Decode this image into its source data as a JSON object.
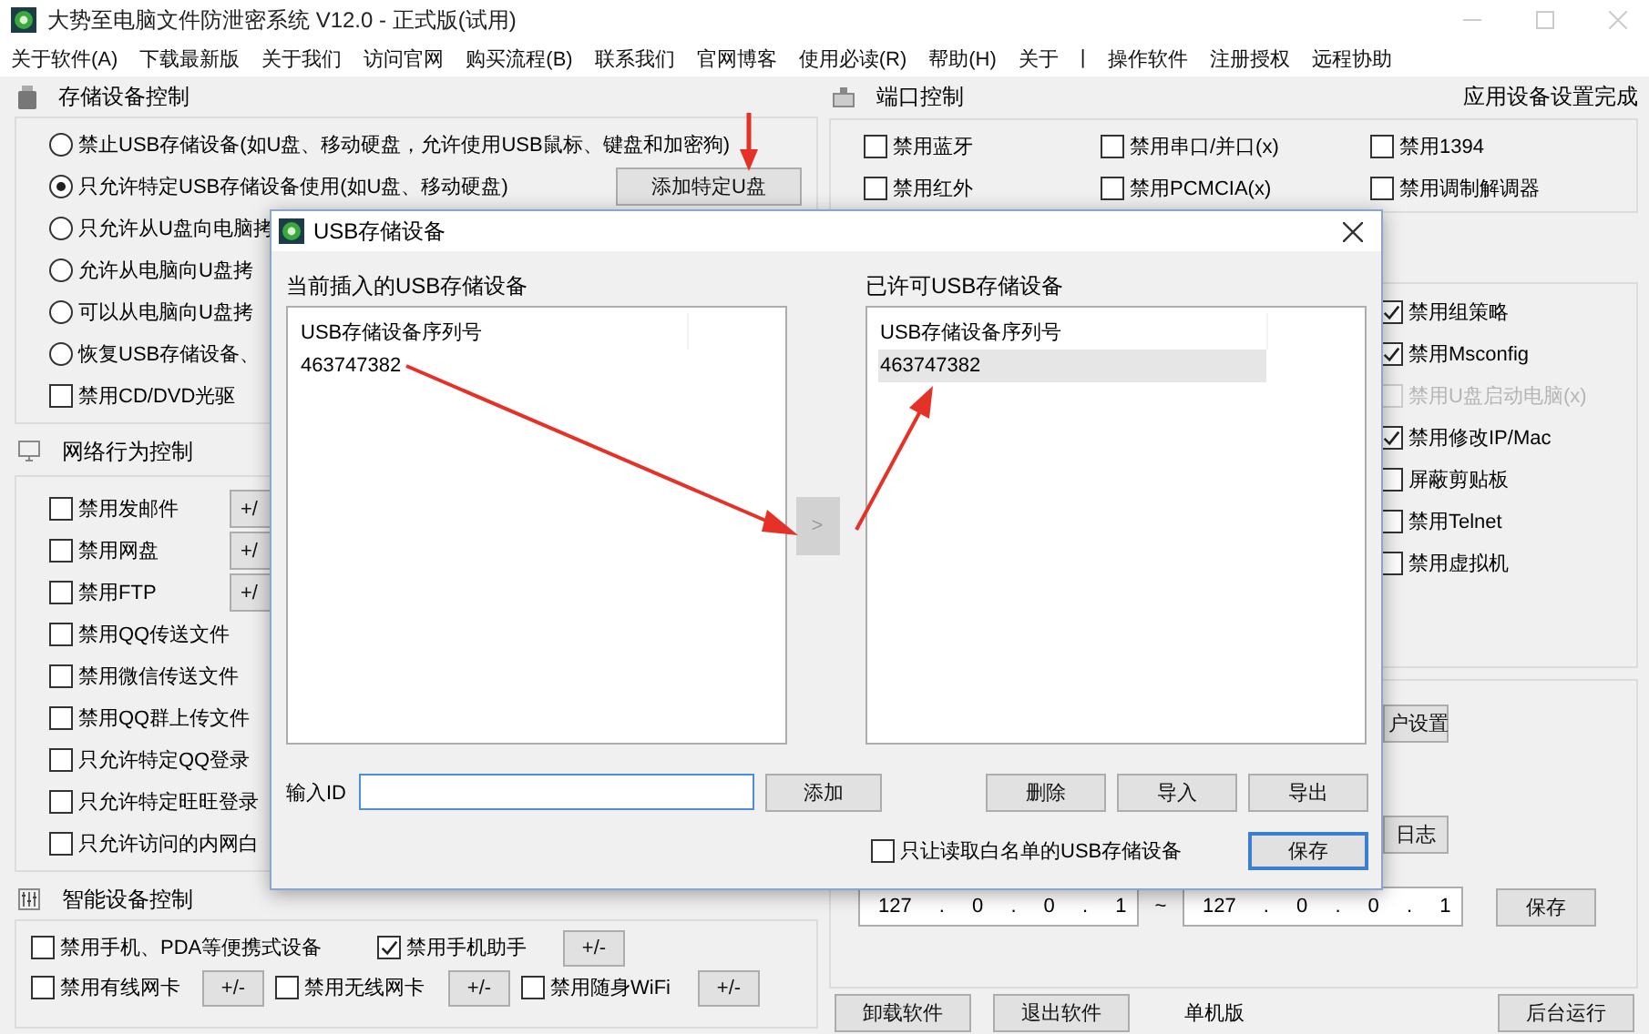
{
  "window": {
    "title": "大势至电脑文件防泄密系统 V12.0 - 正式版(试用)"
  },
  "menu": [
    "关于软件(A)",
    "下载最新版",
    "关于我们",
    "访问官网",
    "购买流程(B)",
    "联系我们",
    "官网博客",
    "使用必读(R)",
    "帮助(H)",
    "关于",
    "|",
    "操作软件",
    "注册授权",
    "远程协助"
  ],
  "storage": {
    "title": "存储设备控制",
    "add_button": "添加特定U盘",
    "options": [
      {
        "label": "禁止USB存储设备(如U盘、移动硬盘，允许使用USB鼠标、键盘和加密狗)",
        "selected": false
      },
      {
        "label": "只允许特定USB存储设备使用(如U盘、移动硬盘)",
        "selected": true
      },
      {
        "label": "只允许从U盘向电脑拷",
        "selected": false
      },
      {
        "label": "允许从电脑向U盘拷",
        "selected": false
      },
      {
        "label": "可以从电脑向U盘拷",
        "selected": false
      },
      {
        "label": "恢复USB存储设备、",
        "selected": false
      }
    ],
    "cd_dvd": {
      "label": "禁用CD/DVD光驱",
      "checked": false
    }
  },
  "network": {
    "title": "网络行为控制",
    "items": [
      {
        "label": "禁用发邮件",
        "checked": false,
        "button": "+/"
      },
      {
        "label": "禁用网盘",
        "checked": false,
        "button": "+/"
      },
      {
        "label": "禁用FTP",
        "checked": false,
        "button": "+/"
      },
      {
        "label": "禁用QQ传送文件",
        "checked": false
      },
      {
        "label": "禁用微信传送文件",
        "checked": false
      },
      {
        "label": "禁用QQ群上传文件",
        "checked": false
      },
      {
        "label": "只允许特定QQ登录",
        "checked": false
      },
      {
        "label": "只允许特定旺旺登录",
        "checked": false
      },
      {
        "label": "只允许访问的内网白",
        "checked": false
      }
    ]
  },
  "smart": {
    "title": "智能设备控制",
    "rows": [
      [
        {
          "label": "禁用手机、PDA等便携式设备",
          "checked": false
        },
        {
          "label": "禁用手机助手",
          "checked": true,
          "button": "+/-"
        }
      ],
      [
        {
          "label": "禁用有线网卡",
          "checked": false,
          "button": "+/-"
        },
        {
          "label": "禁用无线网卡",
          "checked": false,
          "button": "+/-"
        },
        {
          "label": "禁用随身WiFi",
          "checked": false,
          "button": "+/-"
        }
      ]
    ]
  },
  "ports": {
    "title": "端口控制",
    "status": "应用设备设置完成",
    "items": [
      {
        "label": "禁用蓝牙",
        "checked": false
      },
      {
        "label": "禁用串口/并口(x)",
        "checked": false
      },
      {
        "label": "禁用1394",
        "checked": false
      },
      {
        "label": "禁用红外",
        "checked": false
      },
      {
        "label": "禁用PCMCIA(x)",
        "checked": false
      },
      {
        "label": "禁用调制解调器",
        "checked": false
      }
    ]
  },
  "system": {
    "items": [
      {
        "label": "禁用组策略",
        "checked": true,
        "disabled": false
      },
      {
        "label": "禁用Msconfig",
        "checked": true,
        "disabled": false
      },
      {
        "label": "禁用U盘启动电脑(x)",
        "checked": false,
        "disabled": true
      },
      {
        "label": "禁用修改IP/Mac",
        "checked": true,
        "disabled": false
      },
      {
        "label": "屏蔽剪贴板",
        "checked": false,
        "disabled": false
      },
      {
        "label": "禁用Telnet",
        "checked": false,
        "disabled": false
      },
      {
        "label": "禁用虚拟机",
        "checked": false,
        "disabled": false
      }
    ]
  },
  "access": {
    "user_button": "户设置",
    "log_button": "日志",
    "ip_from": "127 . 0 . 0 . 1",
    "separator": "~",
    "ip_to": "127 . 0 . 0 . 1",
    "save_button": "保存"
  },
  "footer": {
    "uninstall_button": "卸载软件",
    "exit_button": "退出软件",
    "edition": "单机版",
    "background_button": "后台运行"
  },
  "dialog": {
    "title": "USB存储设备",
    "left_label": "当前插入的USB存储设备",
    "left_list": {
      "header": "USB存储设备序列号",
      "rows": [
        {
          "text": "463747382",
          "selected": false
        }
      ]
    },
    "move_button": ">",
    "right_label": "已许可USB存储设备",
    "right_list": {
      "header": "USB存储设备序列号",
      "rows": [
        {
          "text": "463747382",
          "selected": true
        }
      ]
    },
    "id_label": "输入ID",
    "add_button": "添加",
    "delete_button": "删除",
    "import_button": "导入",
    "export_button": "导出",
    "whitelist": {
      "label": "只让读取白名单的USB存储设备",
      "checked": false
    },
    "save_button": "保存"
  }
}
